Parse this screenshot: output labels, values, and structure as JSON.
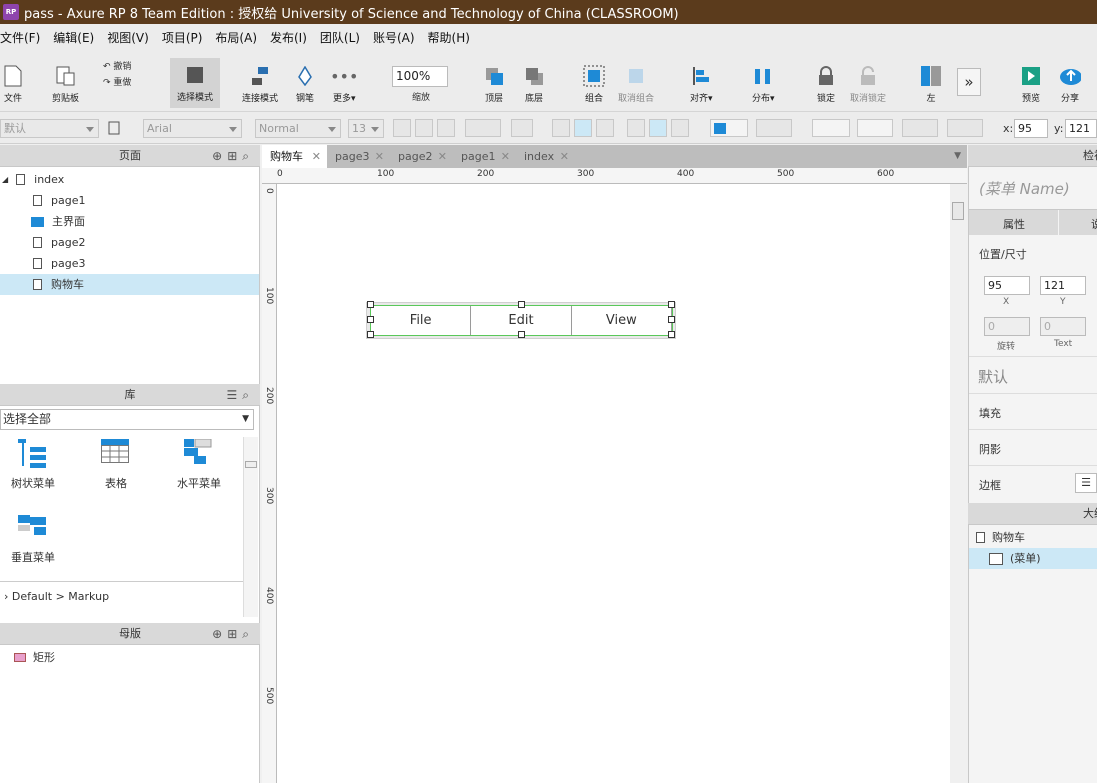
{
  "title": "pass - Axure RP 8 Team Edition : 授权给 University of Science and Technology of China (CLASSROOM)",
  "logo_text": "RP",
  "menu": [
    "文件(F)",
    "编辑(E)",
    "视图(V)",
    "项目(P)",
    "布局(A)",
    "发布(I)",
    "团队(L)",
    "账号(A)",
    "帮助(H)"
  ],
  "toolbar": {
    "file": "文件",
    "clipboard": "剪贴板",
    "undo": "撤销",
    "redo": "重做",
    "select_mode": "选择模式",
    "connect": "连接模式",
    "pen": "钢笔",
    "more": "更多▾",
    "zoom_value": "100%",
    "zoom": "缩放",
    "front": "顶层",
    "back": "底层",
    "group": "组合",
    "ungroup": "取消组合",
    "align": "对齐▾",
    "distribute": "分布▾",
    "lock": "锁定",
    "unlock": "取消锁定",
    "left": "左",
    "preview": "预览",
    "share": "分享"
  },
  "format": {
    "style": "默认",
    "font": "Arial",
    "weight": "Normal",
    "size": "13",
    "x_label": "x:",
    "x": "95",
    "y_label": "y:",
    "y": "121"
  },
  "pages_panel": {
    "title": "页面",
    "items": [
      {
        "label": "index"
      },
      {
        "label": "page1"
      },
      {
        "label": "主界面"
      },
      {
        "label": "page2"
      },
      {
        "label": "page3"
      },
      {
        "label": "购物车"
      }
    ]
  },
  "library_panel": {
    "title": "库",
    "select": "选择全部",
    "items": [
      "树状菜单",
      "表格",
      "水平菜单",
      "垂直菜单"
    ],
    "footer": "Default > Markup"
  },
  "masters_panel": {
    "title": "母版",
    "item": "矩形"
  },
  "tabs": [
    "购物车",
    "page3",
    "page2",
    "page1",
    "index"
  ],
  "ruler_top": [
    "0",
    "100",
    "200",
    "300",
    "400",
    "500",
    "600"
  ],
  "ruler_left": [
    "0",
    "100",
    "200",
    "300",
    "400",
    "500"
  ],
  "widget": {
    "items": [
      "File",
      "Edit",
      "View"
    ]
  },
  "inspector": {
    "title": "检视",
    "name_placeholder": "(菜单 Name)",
    "tab_props": "属性",
    "tab_style": "说",
    "pos_size": "位置/尺寸",
    "x": "95",
    "y": "121",
    "x_label": "X",
    "y_label": "Y",
    "rot": "0",
    "text_rot": "0",
    "rot_label": "旋转",
    "text_label": "Text",
    "default_style": "默认",
    "fill": "填充",
    "shadow": "阴影",
    "border": "边框"
  },
  "outline": {
    "title": "大纲",
    "page": "购物车",
    "item": "(菜单)"
  },
  "colors": {
    "accent": "#1e8ad6",
    "title_bg": "#5b3b1c",
    "selection": "#cce8f6"
  }
}
